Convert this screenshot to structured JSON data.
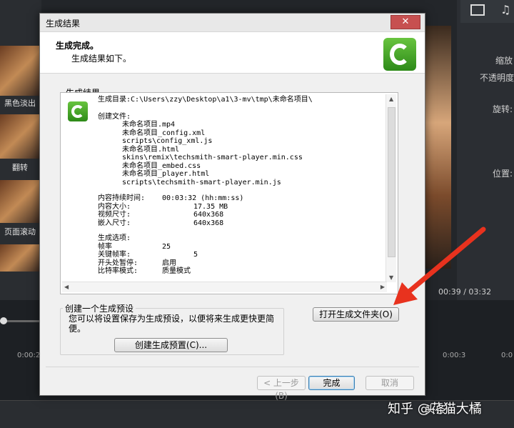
{
  "background": {
    "thumbnails": [
      {
        "label": "黑色淡出"
      },
      {
        "label": "翻转"
      },
      {
        "label": "页面滚动"
      }
    ],
    "right_panel": {
      "scale_label": "缩放",
      "opacity_label": "不透明度",
      "rotate_label": "旋转:",
      "position_label": "位置:"
    },
    "time_readout": "00:39  /  03:32",
    "ruler_ticks": [
      "0:00:2",
      "0:00:3",
      "0:0"
    ],
    "watermark": "知乎 @花猫大橘",
    "watermark_overlay": "头条"
  },
  "dialog": {
    "title": "生成结果",
    "close_label": "✕",
    "header_title": "生成完成。",
    "header_subtitle": "生成结果如下。",
    "results_group_label": "生成结果",
    "output_dir_line": "生成目录:C:\\Users\\zzy\\Desktop\\a1\\3-mv\\tmp\\未命名项目\\",
    "created_files_label": "创建文件:",
    "files": [
      "未命名项目.mp4",
      "未命名项目_config.xml",
      "scripts\\config_xml.js",
      "未命名项目.html",
      "skins\\remix\\techsmith-smart-player.min.css",
      "未命名项目_embed.css",
      "未命名项目_player.html",
      "scripts\\techsmith-smart-player.min.js"
    ],
    "stats": [
      {
        "label": "内容持续时间:",
        "value": "00:03:32 (hh:mm:ss)"
      },
      {
        "label": "内容大小:",
        "value": "17.35 MB"
      },
      {
        "label": "视频尺寸:",
        "value": "640x368"
      },
      {
        "label": "嵌入尺寸:",
        "value": "640x368"
      }
    ],
    "options_label": "生成选项:",
    "options": [
      {
        "label": "帧率",
        "value": "25"
      },
      {
        "label": "关键帧率:",
        "value": "5"
      },
      {
        "label": "开头处暂停:",
        "value": "启用"
      },
      {
        "label": "比特率模式:",
        "value": "质量模式"
      }
    ],
    "open_folder_button": "打开生成文件夹(O)",
    "preset_group_label": "创建一个生成预设",
    "preset_desc": "您可以将设置保存为生成预设，以便将来生成更快更简便。",
    "create_preset_button": "创建生成预置(C)...",
    "back_button": "< 上一步(B)",
    "finish_button": "完成",
    "cancel_button": "取消"
  }
}
